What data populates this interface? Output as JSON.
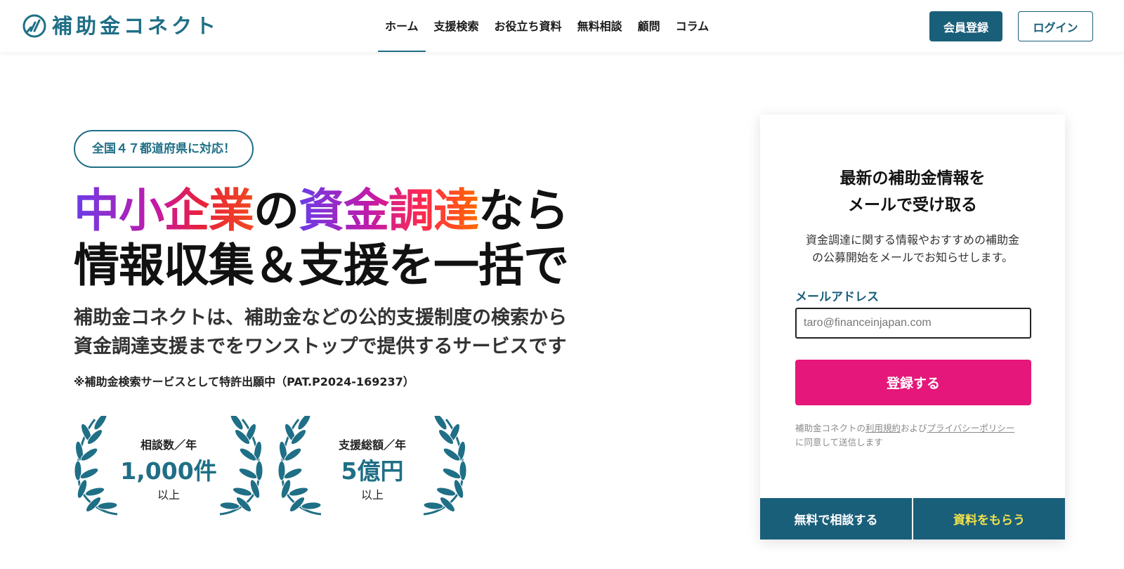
{
  "header": {
    "logo_text": "補助金コネクト",
    "nav": [
      {
        "label": "ホーム",
        "active": true
      },
      {
        "label": "支援検索"
      },
      {
        "label": "お役立ち資料"
      },
      {
        "label": "無料相談"
      },
      {
        "label": "顧問"
      },
      {
        "label": "コラム"
      }
    ],
    "register_label": "会員登録",
    "login_label": "ログイン"
  },
  "hero": {
    "badge": "全国４７都道府県に対応！",
    "headline_part1": "中小企業",
    "headline_part2": "の",
    "headline_part3": "資金調達",
    "headline_part4": "なら",
    "headline_line2": "情報収集＆支援を一括で",
    "sub_line1": "補助金コネクトは、補助金などの公的支援制度の検索から",
    "sub_line2": "資金調達支援までをワンストップで提供するサービスです",
    "patent": "※補助金検索サービスとして特許出願中（PAT.P2024-169237）"
  },
  "awards": [
    {
      "label": "相談数／年",
      "value": "1,000件",
      "suffix": "以上"
    },
    {
      "label": "支援総額／年",
      "value": "5億円",
      "suffix": "以上"
    }
  ],
  "card": {
    "title_line1": "最新の補助金情報を",
    "title_line2": "メールで受け取る",
    "desc_line1": "資金調達に関する情報やおすすめの補助金",
    "desc_line2": "の公募開始をメールでお知らせします。",
    "email_label": "メールアドレス",
    "email_placeholder": "taro@financeinjapan.com",
    "submit_label": "登録する",
    "consent_prefix": "補助金コネクトの",
    "terms_link": "利用規約",
    "consent_and": "および",
    "privacy_link": "プライバシーポリシー",
    "consent_suffix": "に同意して送信します",
    "consult_label": "無料で相談する",
    "docs_label": "資料をもらう"
  },
  "colors": {
    "brand": "#1f6f86",
    "brand_dark": "#1a5f7a",
    "cta_pink": "#e5177a",
    "docs_yellow": "#f3e24b"
  }
}
